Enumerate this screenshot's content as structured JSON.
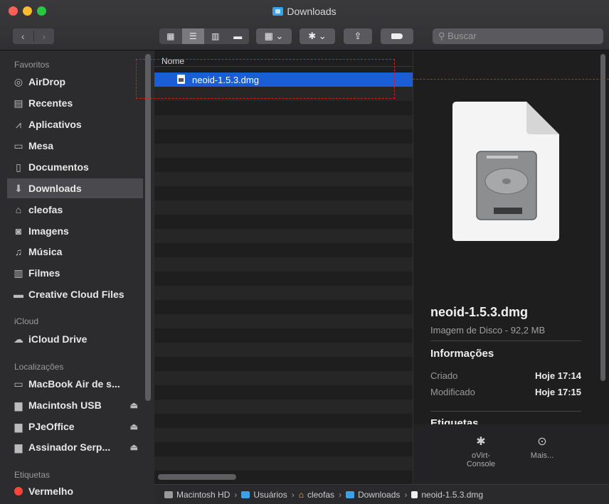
{
  "window": {
    "title": "Downloads"
  },
  "toolbar": {
    "back_icon": "chevron-left",
    "forward_icon": "chevron-right",
    "view_icons": [
      "icon-view",
      "list-view",
      "column-view",
      "gallery-view"
    ],
    "arrange_icon": "grid-arrange",
    "action_icon": "gear",
    "share_icon": "share",
    "tag_icon": "tag",
    "search_placeholder": "Buscar"
  },
  "sidebar": {
    "favorites_header": "Favoritos",
    "favorites": [
      {
        "label": "AirDrop",
        "icon": "airdrop-icon"
      },
      {
        "label": "Recentes",
        "icon": "recents-icon"
      },
      {
        "label": "Aplicativos",
        "icon": "applications-icon"
      },
      {
        "label": "Mesa",
        "icon": "desktop-icon"
      },
      {
        "label": "Documentos",
        "icon": "documents-icon"
      },
      {
        "label": "Downloads",
        "icon": "downloads-icon",
        "selected": true
      },
      {
        "label": "cleofas",
        "icon": "home-icon"
      },
      {
        "label": "Imagens",
        "icon": "pictures-icon"
      },
      {
        "label": "Música",
        "icon": "music-icon"
      },
      {
        "label": "Filmes",
        "icon": "movies-icon"
      },
      {
        "label": "Creative Cloud Files",
        "icon": "folder-icon"
      }
    ],
    "icloud_header": "iCloud",
    "icloud": [
      {
        "label": "iCloud Drive",
        "icon": "cloud-icon"
      }
    ],
    "locations_header": "Localizações",
    "locations": [
      {
        "label": "MacBook Air de s...",
        "icon": "laptop-icon"
      },
      {
        "label": "Macintosh USB",
        "icon": "drive-icon",
        "eject": true
      },
      {
        "label": "PJeOffice",
        "icon": "drive-icon",
        "eject": true
      },
      {
        "label": "Assinador Serp...",
        "icon": "drive-icon",
        "eject": true
      }
    ],
    "tags_header": "Etiquetas",
    "tags": [
      {
        "label": "Vermelho",
        "color": "#ff453a"
      }
    ]
  },
  "filelist": {
    "column_header": "Nome",
    "files": [
      {
        "name": "neoid-1.5.3.dmg",
        "selected": true
      }
    ]
  },
  "preview": {
    "name": "neoid-1.5.3.dmg",
    "kind": "Imagem de Disco - 92,2 MB",
    "info_header": "Informações",
    "created_label": "Criado",
    "created_value": "Hoje 17:14",
    "modified_label": "Modificado",
    "modified_value": "Hoje 17:15",
    "tags_header": "Etiquetas",
    "actions": [
      {
        "label": "oVirt-\nConsole",
        "icon": "gear-icon"
      },
      {
        "label": "Mais...",
        "icon": "more-icon"
      }
    ]
  },
  "pathbar": {
    "items": [
      "Macintosh HD",
      "Usuários",
      "cleofas",
      "Downloads",
      "neoid-1.5.3.dmg"
    ],
    "separator": "›"
  },
  "colors": {
    "selection": "#1a5ed6",
    "annotation": "#d02020"
  }
}
